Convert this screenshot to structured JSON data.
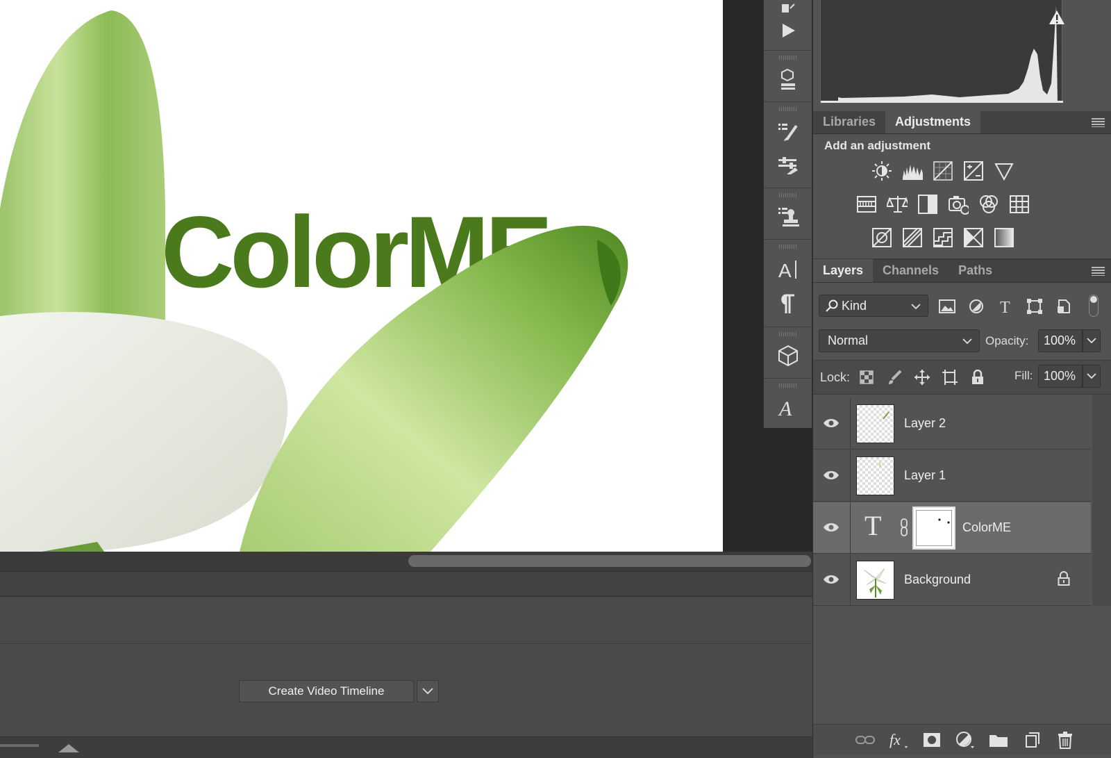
{
  "document": {
    "text_layer_content": "ColorME"
  },
  "timeline": {
    "create_button_label": "Create Video Timeline"
  },
  "adjustments_panel": {
    "tabs": [
      {
        "label": "Libraries",
        "active": false
      },
      {
        "label": "Adjustments",
        "active": true
      }
    ],
    "title": "Add an adjustment",
    "icons_row1": [
      "brightness-contrast-icon",
      "levels-icon",
      "curves-icon",
      "exposure-icon",
      "vibrance-icon"
    ],
    "icons_row2": [
      "hue-saturation-icon",
      "color-balance-icon",
      "black-white-icon",
      "photo-filter-icon",
      "channel-mixer-icon",
      "color-lookup-icon"
    ],
    "icons_row3": [
      "invert-icon",
      "posterize-icon",
      "threshold-icon",
      "selective-color-icon",
      "gradient-map-icon"
    ]
  },
  "layers_panel": {
    "tabs": [
      {
        "label": "Layers",
        "active": true
      },
      {
        "label": "Channels",
        "active": false
      },
      {
        "label": "Paths",
        "active": false
      }
    ],
    "filter_kind": "Kind",
    "blend_mode": "Normal",
    "opacity_label": "Opacity:",
    "opacity_value": "100%",
    "lock_label": "Lock:",
    "fill_label": "Fill:",
    "fill_value": "100%",
    "layers": [
      {
        "name": "Layer 2",
        "type": "pixel",
        "visible": true,
        "selected": false
      },
      {
        "name": "Layer 1",
        "type": "pixel",
        "visible": true,
        "selected": false
      },
      {
        "name": "ColorME",
        "type": "text",
        "visible": true,
        "selected": true
      },
      {
        "name": "Background",
        "type": "image",
        "visible": true,
        "locked": true,
        "selected": false
      }
    ]
  },
  "colors": {
    "panel_bg": "#535353",
    "workspace_bg": "#282828",
    "text_green": "#4a7a1c",
    "selected_row": "#6b6b6b"
  }
}
